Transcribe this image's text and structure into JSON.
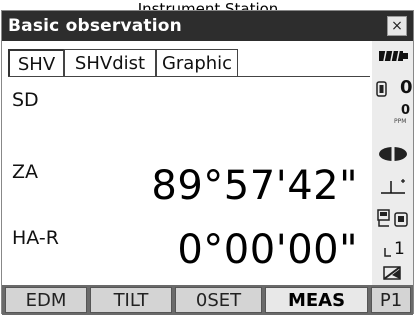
{
  "caption": "Instrument Station",
  "window": {
    "title": "Basic observation",
    "close_glyph": "×"
  },
  "tabs": [
    {
      "label": "SHV",
      "active": true
    },
    {
      "label": "SHVdist",
      "active": false
    },
    {
      "label": "Graphic",
      "active": false
    }
  ],
  "measurements": [
    {
      "label": "SD",
      "value": ""
    },
    {
      "label": "ZA",
      "value": "89°57'42\""
    },
    {
      "label": "HA-R",
      "value": "0°00'00\""
    }
  ],
  "status": {
    "prism_constant": "0",
    "ppm_value": "0",
    "ppm_unit": "PPM",
    "face_number": "1",
    "icons": [
      "battery-icon",
      "prism-icon",
      "ppm-icon",
      "target-icon",
      "tilt-icon",
      "communication-icon",
      "face-icon",
      "input-mode-icon"
    ]
  },
  "softkeys": [
    {
      "label": "EDM"
    },
    {
      "label": "TILT"
    },
    {
      "label": "0SET"
    },
    {
      "label": "MEAS"
    },
    {
      "label": "P1"
    }
  ]
}
